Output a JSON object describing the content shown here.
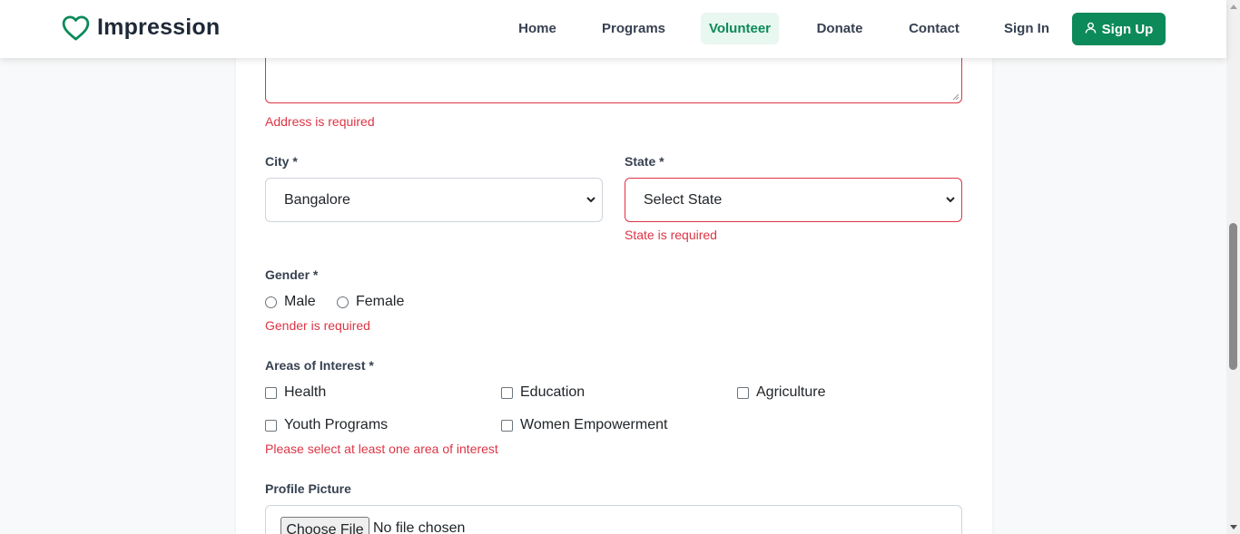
{
  "brand": {
    "name": "Impression",
    "icon": "heart-icon",
    "color": "#0d8a5a"
  },
  "nav": {
    "items": [
      {
        "label": "Home",
        "active": false
      },
      {
        "label": "Programs",
        "active": false
      },
      {
        "label": "Volunteer",
        "active": true
      },
      {
        "label": "Donate",
        "active": false
      },
      {
        "label": "Contact",
        "active": false
      },
      {
        "label": "Sign In",
        "active": false
      }
    ],
    "signup_label": "Sign Up",
    "signup_icon": "user-icon"
  },
  "form": {
    "address": {
      "value": "",
      "error": "Address is required"
    },
    "city": {
      "label": "City *",
      "selected": "Bangalore"
    },
    "state": {
      "label": "State *",
      "selected": "Select State",
      "error": "State is required"
    },
    "gender": {
      "label": "Gender *",
      "options": [
        "Male",
        "Female"
      ],
      "error": "Gender is required"
    },
    "interests": {
      "label": "Areas of Interest *",
      "options": [
        "Health",
        "Education",
        "Agriculture",
        "Youth Programs",
        "Women Empowerment"
      ],
      "error": "Please select at least one area of interest"
    },
    "profile_picture": {
      "label": "Profile Picture",
      "button": "Choose File",
      "status": "No file chosen"
    }
  },
  "colors": {
    "accent": "#0d8a5a",
    "error": "#dc3545"
  }
}
